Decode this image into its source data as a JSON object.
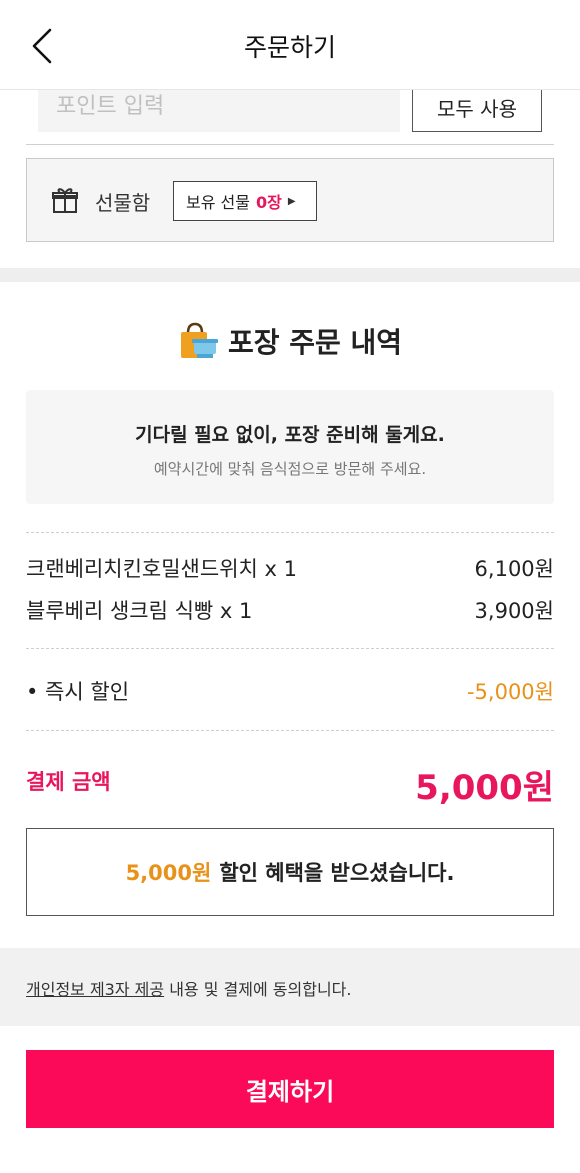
{
  "header": {
    "title": "주문하기"
  },
  "points": {
    "placeholder": "포인트 입력",
    "use_all_label": "모두 사용"
  },
  "giftbox": {
    "label": "선물함",
    "chip_prefix": "보유 선물",
    "chip_count": "0장"
  },
  "order": {
    "title": "포장 주문 내역",
    "notice_main": "기다릴 필요 없이, 포장 준비해 둘게요.",
    "notice_sub": "예약시간에 맞춰 음식점으로 방문해 주세요.",
    "items": [
      {
        "name": "크랜베리치킨호밀샌드위치 x 1",
        "price": "6,100원"
      },
      {
        "name": "블루베리 생크림 식빵 x 1",
        "price": "3,900원"
      }
    ],
    "discount": {
      "name": "• 즉시 할인",
      "amount": "-5,000원"
    },
    "total": {
      "label": "결제 금액",
      "amount": "5,000원"
    },
    "benefit": {
      "amount": "5,000원",
      "text": "할인 혜택을 받으셨습니다."
    }
  },
  "agreement": {
    "link_text": "개인정보 제3자 제공",
    "rest_text": " 내용 및 결제에 동의합니다."
  },
  "pay_button": {
    "label": "결제하기"
  },
  "colors": {
    "accent": "#fc0a5a",
    "highlight": "#e8175d",
    "discount": "#e8921a"
  }
}
